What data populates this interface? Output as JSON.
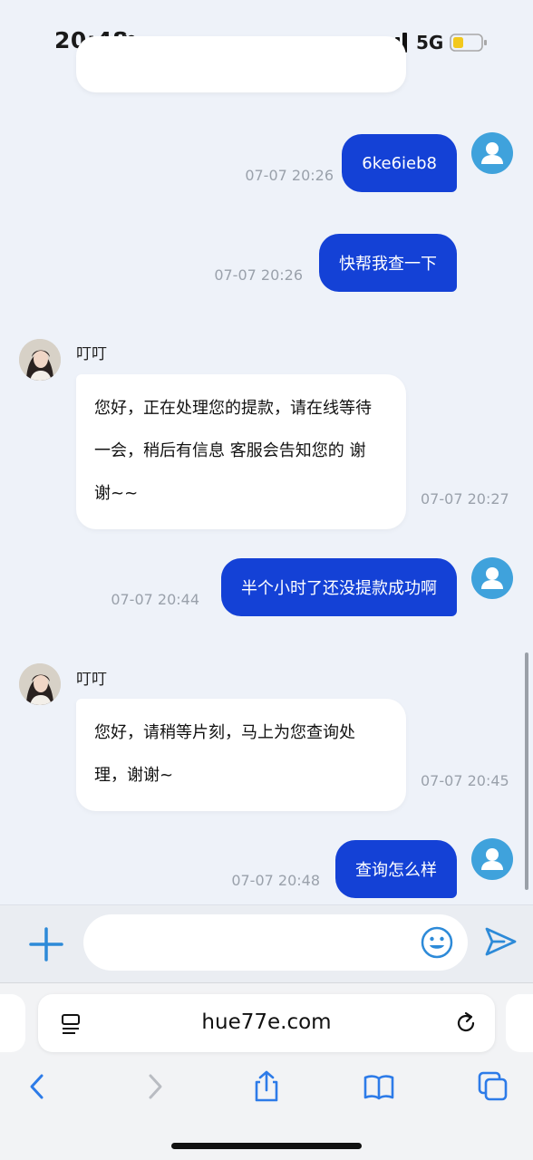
{
  "status_bar": {
    "time": "20:48",
    "network": "5G"
  },
  "chat": {
    "messages": [
      {
        "side": "sent",
        "text": "6ke6ieb8",
        "time": "07-07 20:26"
      },
      {
        "side": "sent",
        "text": "快帮我查一下",
        "time": "07-07 20:26"
      },
      {
        "side": "received",
        "name": "叮叮",
        "lines": [
          "您好，正在处理您的提款，请在线等待",
          "一会，稍后有信息 客服会告知您的 谢",
          "谢~~"
        ],
        "time": "07-07 20:27"
      },
      {
        "side": "sent",
        "text": "半个小时了还没提款成功啊",
        "time": "07-07 20:44"
      },
      {
        "side": "received",
        "name": "叮叮",
        "lines": [
          "您好，请稍等片刻，马上为您查询处",
          "理，谢谢~"
        ],
        "time": "07-07 20:45"
      },
      {
        "side": "sent",
        "text": "查询怎么样",
        "time": "07-07 20:48"
      }
    ]
  },
  "input": {
    "placeholder": ""
  },
  "browser": {
    "url": "hue77e.com"
  },
  "colors": {
    "accent": "#1441d6",
    "avatar_user": "#3fa2dc",
    "icon_blue": "#2d8ad8",
    "background": "#eef2f9"
  }
}
